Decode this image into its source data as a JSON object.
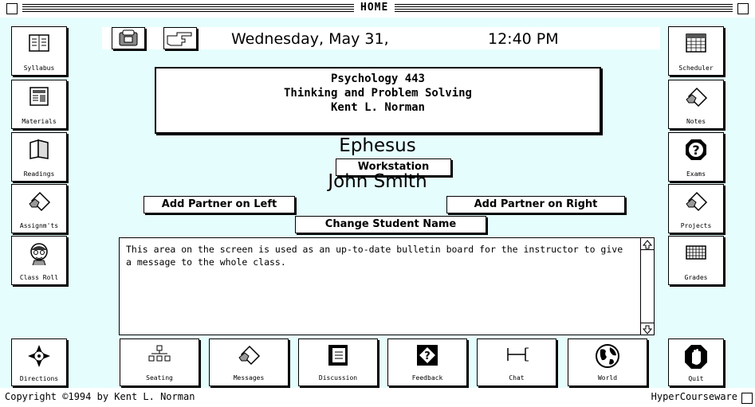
{
  "window": {
    "title": "HOME"
  },
  "header": {
    "date": "Wednesday, May 31,",
    "time": "12:40 PM"
  },
  "course": {
    "line1": "Psychology 443",
    "line2": "Thinking and Problem Solving",
    "line3": "Kent L. Norman"
  },
  "location": {
    "name": "Ephesus",
    "workstation_label": "Workstation"
  },
  "student": {
    "name": "John Smith",
    "add_left_label": "Add Partner on Left",
    "add_right_label": "Add Partner on Right",
    "change_name_label": "Change Student Name"
  },
  "bulletin": {
    "text": "This area on the screen is used as an up-to-date bulletin board for the instructor to give a message to the whole class."
  },
  "left_nav": [
    {
      "label": "Syllabus",
      "icon": "book-icon"
    },
    {
      "label": "Materials",
      "icon": "newspaper-icon"
    },
    {
      "label": "Readings",
      "icon": "open-book-icon"
    },
    {
      "label": "Assignm'ts",
      "icon": "hand-paper-icon"
    },
    {
      "label": "Class Roll",
      "icon": "person-face-icon"
    }
  ],
  "right_nav": [
    {
      "label": "Scheduler",
      "icon": "calendar-icon"
    },
    {
      "label": "Notes",
      "icon": "hand-paper-icon"
    },
    {
      "label": "Exams",
      "icon": "question-icon"
    },
    {
      "label": "Projects",
      "icon": "hand-paper-icon"
    },
    {
      "label": "Grades",
      "icon": "gradebook-icon"
    }
  ],
  "bottom_nav": [
    {
      "label": "Directions",
      "icon": "compass-icon"
    },
    {
      "label": "Seating",
      "icon": "seating-chart-icon"
    },
    {
      "label": "Messages",
      "icon": "hand-paper-icon"
    },
    {
      "label": "Discussion",
      "icon": "discussion-icon"
    },
    {
      "label": "Feedback",
      "icon": "feedback-icon"
    },
    {
      "label": "Chat",
      "icon": "chat-icon"
    },
    {
      "label": "World",
      "icon": "globe-icon"
    },
    {
      "label": "Quit",
      "icon": "stop-hand-icon"
    }
  ],
  "footer": {
    "copyright": "Copyright ©1994 by Kent L. Norman",
    "brand": "HyperCourseware"
  }
}
